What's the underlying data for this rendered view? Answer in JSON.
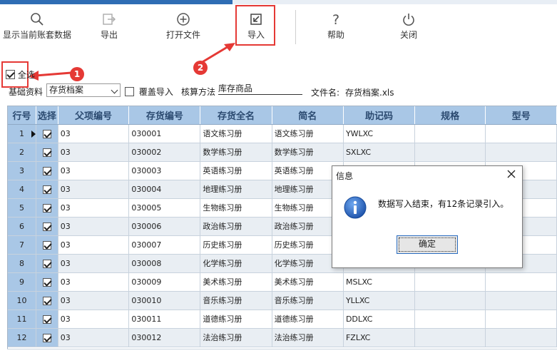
{
  "toolbar": {
    "buttons": [
      {
        "label": "显示当前账套数据",
        "icon": "search-icon"
      },
      {
        "label": "导出",
        "icon": "export-icon"
      },
      {
        "label": "打开文件",
        "icon": "add-circle-icon"
      },
      {
        "label": "导入",
        "icon": "import-icon"
      },
      {
        "label": "帮助",
        "icon": "help-icon"
      },
      {
        "label": "关闭",
        "icon": "power-icon"
      }
    ]
  },
  "annotations": {
    "badge1": "1",
    "badge2": "2"
  },
  "filters": {
    "select_all_label": "全选",
    "select_all_checked": true,
    "base_data_label": "基础资料",
    "base_data_value": "存货档案",
    "overwrite_label": "覆盖导入",
    "overwrite_checked": false,
    "method_label": "核算方法",
    "method_value": "库存商品",
    "filename_label": "文件名:",
    "filename_value": "存货档案.xls"
  },
  "table": {
    "columns": [
      "行号",
      "选择",
      "父项编号",
      "存货编号",
      "存货全名",
      "简名",
      "助记码",
      "规格",
      "型号"
    ],
    "rows": [
      {
        "no": "1",
        "checked": true,
        "parent": "03",
        "code": "030001",
        "name": "语文练习册",
        "short": "语文练习册",
        "mnemonic": "YWLXC"
      },
      {
        "no": "2",
        "checked": true,
        "parent": "03",
        "code": "030002",
        "name": "数学练习册",
        "short": "数学练习册",
        "mnemonic": "SXLXC"
      },
      {
        "no": "3",
        "checked": true,
        "parent": "03",
        "code": "030003",
        "name": "英语练习册",
        "short": "英语练习册",
        "mnemonic": ""
      },
      {
        "no": "4",
        "checked": true,
        "parent": "03",
        "code": "030004",
        "name": "地理练习册",
        "short": "地理练习册",
        "mnemonic": ""
      },
      {
        "no": "5",
        "checked": true,
        "parent": "03",
        "code": "030005",
        "name": "生物练习册",
        "short": "生物练习册",
        "mnemonic": ""
      },
      {
        "no": "6",
        "checked": true,
        "parent": "03",
        "code": "030006",
        "name": "政治练习册",
        "short": "政治练习册",
        "mnemonic": ""
      },
      {
        "no": "7",
        "checked": true,
        "parent": "03",
        "code": "030007",
        "name": "历史练习册",
        "short": "历史练习册",
        "mnemonic": ""
      },
      {
        "no": "8",
        "checked": true,
        "parent": "03",
        "code": "030008",
        "name": "化学练习册",
        "short": "化学练习册",
        "mnemonic": ""
      },
      {
        "no": "9",
        "checked": true,
        "parent": "03",
        "code": "030009",
        "name": "美术练习册",
        "short": "美术练习册",
        "mnemonic": "MSLXC"
      },
      {
        "no": "10",
        "checked": true,
        "parent": "03",
        "code": "030010",
        "name": "音乐练习册",
        "short": "音乐练习册",
        "mnemonic": "YLLXC"
      },
      {
        "no": "11",
        "checked": true,
        "parent": "03",
        "code": "030011",
        "name": "道德练习册",
        "short": "道德练习册",
        "mnemonic": "DDLXC"
      },
      {
        "no": "12",
        "checked": true,
        "parent": "03",
        "code": "030012",
        "name": "法治练习册",
        "short": "法治练习册",
        "mnemonic": "FZLXC"
      }
    ]
  },
  "dialog": {
    "title": "信息",
    "message": "数据写入结束，有12条记录引入。",
    "ok_label": "确定",
    "icon": "info-icon"
  },
  "colors": {
    "accent": "#2f6db4",
    "highlight": "#e53935",
    "header_bg": "#a9c7e6"
  }
}
